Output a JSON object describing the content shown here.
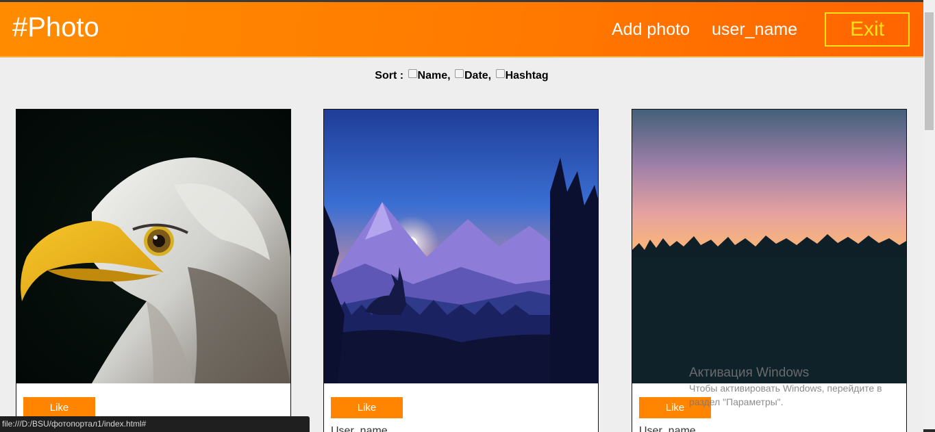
{
  "header": {
    "logo": "#Photo",
    "add_photo": "Add photo",
    "user_name": "user_name",
    "exit": "Exit"
  },
  "sort": {
    "label": "Sort :",
    "options": [
      "Name,",
      "Date,",
      "Hashtag"
    ]
  },
  "cards": [
    {
      "photo": "eagle-photo",
      "like": "Like",
      "user": ""
    },
    {
      "photo": "mountain-landscape-photo",
      "like": "Like",
      "user": "User_name"
    },
    {
      "photo": "sunset-forest-photo",
      "like": "Like",
      "user": "User_name"
    }
  ],
  "watermark": {
    "title": "Активация Windows",
    "text": "Чтобы активировать Windows, перейдите в раздел \"Параметры\"."
  },
  "status_bar": {
    "url": "file:///D:/BSU/фотопортал1/index.html#"
  },
  "colors": {
    "header_orange": "#ff7a00",
    "exit_yellow": "#f3e21a",
    "like_orange": "#ff8400",
    "background": "#eeeeee"
  }
}
